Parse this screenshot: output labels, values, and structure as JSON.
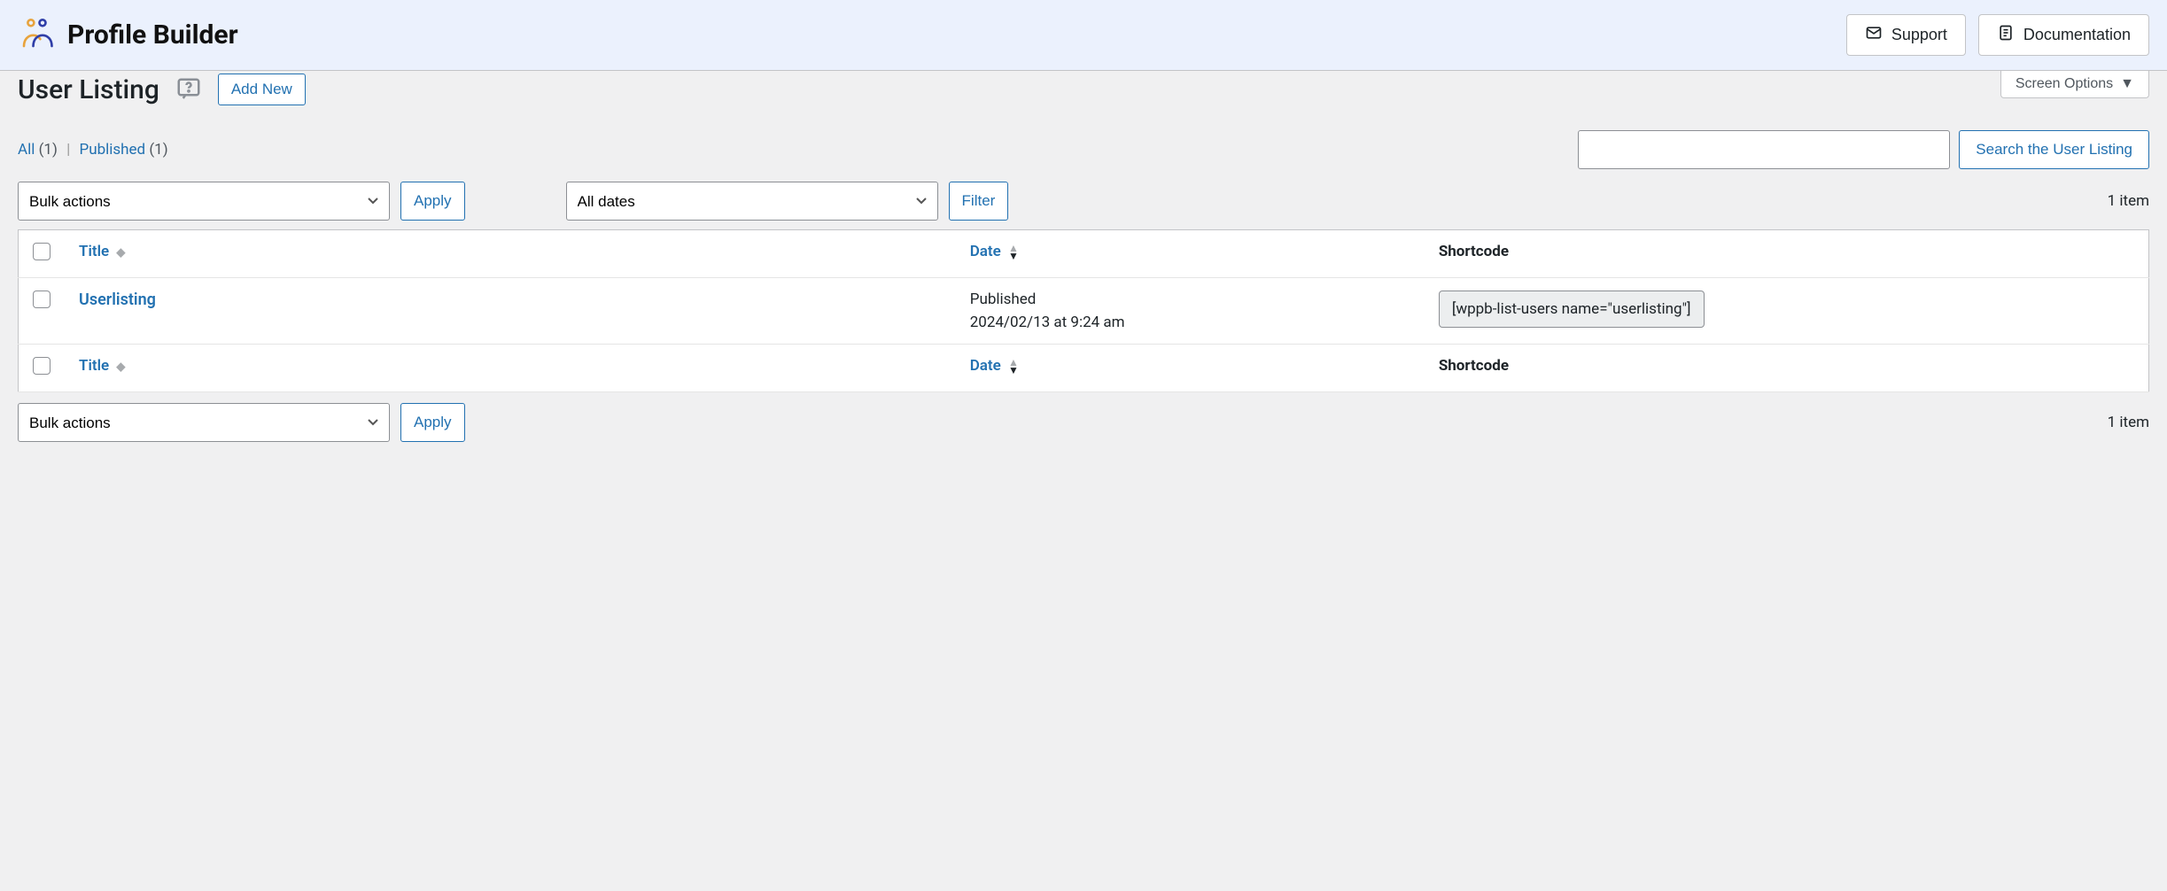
{
  "header": {
    "brand": "Profile Builder",
    "support": "Support",
    "documentation": "Documentation"
  },
  "screen_options": "Screen Options",
  "page": {
    "title": "User Listing",
    "add_new": "Add New"
  },
  "status_filters": {
    "all_label": "All",
    "all_count": "(1)",
    "published_label": "Published",
    "published_count": "(1)"
  },
  "search": {
    "value": "",
    "button": "Search the User Listing"
  },
  "bulk_actions": {
    "label": "Bulk actions",
    "apply": "Apply"
  },
  "date_filter": {
    "label": "All dates",
    "filter": "Filter"
  },
  "item_count": "1 item",
  "columns": {
    "title": "Title",
    "date": "Date",
    "shortcode": "Shortcode"
  },
  "rows": [
    {
      "title": "Userlisting",
      "date_status": "Published",
      "date_time": "2024/02/13 at 9:24 am",
      "shortcode": "[wppb-list-users name=\"userlisting\"]"
    }
  ]
}
